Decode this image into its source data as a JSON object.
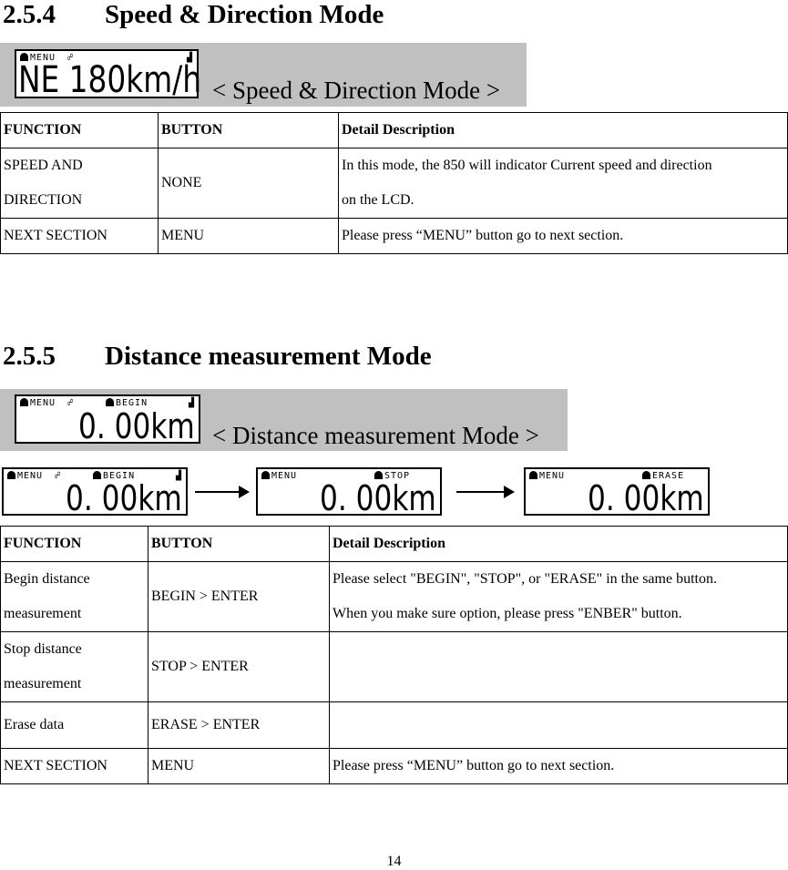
{
  "section_254": {
    "number": "2.5.4",
    "title": "Speed & Direction Mode",
    "caption": "< Speed & Direction Mode >",
    "lcd": {
      "top_left": "MENU",
      "icons": [
        "bell-icon",
        "satellite-icon",
        "signal-icon"
      ],
      "main_text": "NE 180km/h"
    },
    "table": {
      "headers": [
        "FUNCTION",
        "BUTTON",
        "Detail Description"
      ],
      "rows": [
        {
          "function_line1": "SPEED AND",
          "function_line2": "DIRECTION",
          "button": "NONE",
          "desc_line1": "In this mode, the 850 will indicator Current speed and direction",
          "desc_line2": "on the LCD."
        },
        {
          "function": "NEXT SECTION",
          "button": "MENU",
          "desc": "Please press “MENU” button go to next section."
        }
      ]
    }
  },
  "section_255": {
    "number": "2.5.5",
    "title": "Distance measurement Mode",
    "caption": "< Distance measurement Mode >",
    "lcd": {
      "top_left": "MENU",
      "top_right": "BEGIN",
      "main_text": "0. 00km"
    },
    "flow": [
      {
        "top_left": "MENU",
        "top_right": "BEGIN",
        "main_text": "0. 00km"
      },
      {
        "top_left": "MENU",
        "top_right": "STOP",
        "main_text": "0. 00km"
      },
      {
        "top_left": "MENU",
        "top_right": "ERASE",
        "main_text": "0. 00km"
      }
    ],
    "table": {
      "headers": [
        "FUNCTION",
        "BUTTON",
        "Detail Description"
      ],
      "rows": [
        {
          "function_line1": "Begin distance",
          "function_line2": "measurement",
          "button": "BEGIN > ENTER",
          "desc_line1": "Please select \"BEGIN\", \"STOP\", or \"ERASE\" in the same button.",
          "desc_line2": "When you make sure option, please press \"ENBER\" button."
        },
        {
          "function_line1": "Stop distance",
          "function_line2": "measurement",
          "button": "STOP > ENTER",
          "desc": ""
        },
        {
          "function": "Erase data",
          "button": "ERASE > ENTER",
          "desc": ""
        },
        {
          "function": "NEXT SECTION",
          "button": "MENU",
          "desc": "Please press “MENU” button go to next section."
        }
      ]
    }
  },
  "page_number": "14"
}
